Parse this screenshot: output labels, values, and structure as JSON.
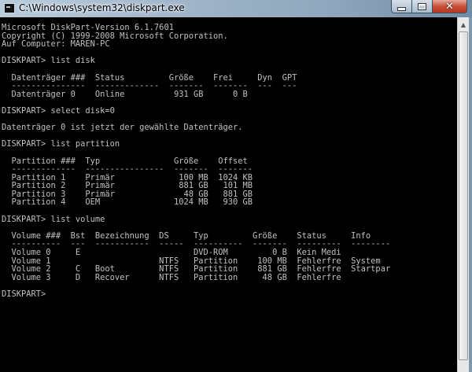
{
  "window": {
    "title": "C:\\Windows\\system32\\diskpart.exe"
  },
  "console": {
    "lines": [
      "Microsoft DiskPart-Version 6.1.7601",
      "Copyright (C) 1999-2008 Microsoft Corporation.",
      "Auf Computer: MAREN-PC",
      "",
      "DISKPART> list disk",
      "",
      "  Datenträger ###  Status         Größe    Frei     Dyn  GPT",
      "  ---------------  -------------  -------  -------  ---  ---",
      "  Datenträger 0    Online          931 GB      0 B",
      "",
      "DISKPART> select disk=0",
      "",
      "Datenträger 0 ist jetzt der gewählte Datenträger.",
      "",
      "DISKPART> list partition",
      "",
      "  Partition ###  Typ               Größe    Offset",
      "  -------------  ----------------  -------  -------",
      "  Partition 1    Primär             100 MB  1024 KB",
      "  Partition 2    Primär             881 GB   101 MB",
      "  Partition 3    Primär              48 GB   881 GB",
      "  Partition 4    OEM               1024 MB   930 GB",
      "",
      "DISKPART> list volume",
      "",
      "  Volume ###  Bst  Bezeichnung  DS     Typ         Größe    Status     Info",
      "  ----------  ---  -----------  -----  ----------  -------  ---------  --------",
      "  Volume 0     E                       DVD-ROM         0 B  Kein Medi",
      "  Volume 1                      NTFS   Partition    100 MB  Fehlerfre  System",
      "  Volume 2     C   Boot         NTFS   Partition    881 GB  Fehlerfre  Startpar",
      "  Volume 3     D   Recover      NTFS   Partition     48 GB  Fehlerfre",
      "",
      "DISKPART> "
    ]
  },
  "icons": {
    "app": "console-app-icon",
    "minimize": "minimize-icon",
    "maximize": "maximize-icon",
    "close": "close-icon",
    "scroll_up": "scroll-up-arrow-icon"
  },
  "colors": {
    "console_background": "#000000",
    "console_text": "#c0c0c0",
    "close_button": "#c7503a"
  }
}
